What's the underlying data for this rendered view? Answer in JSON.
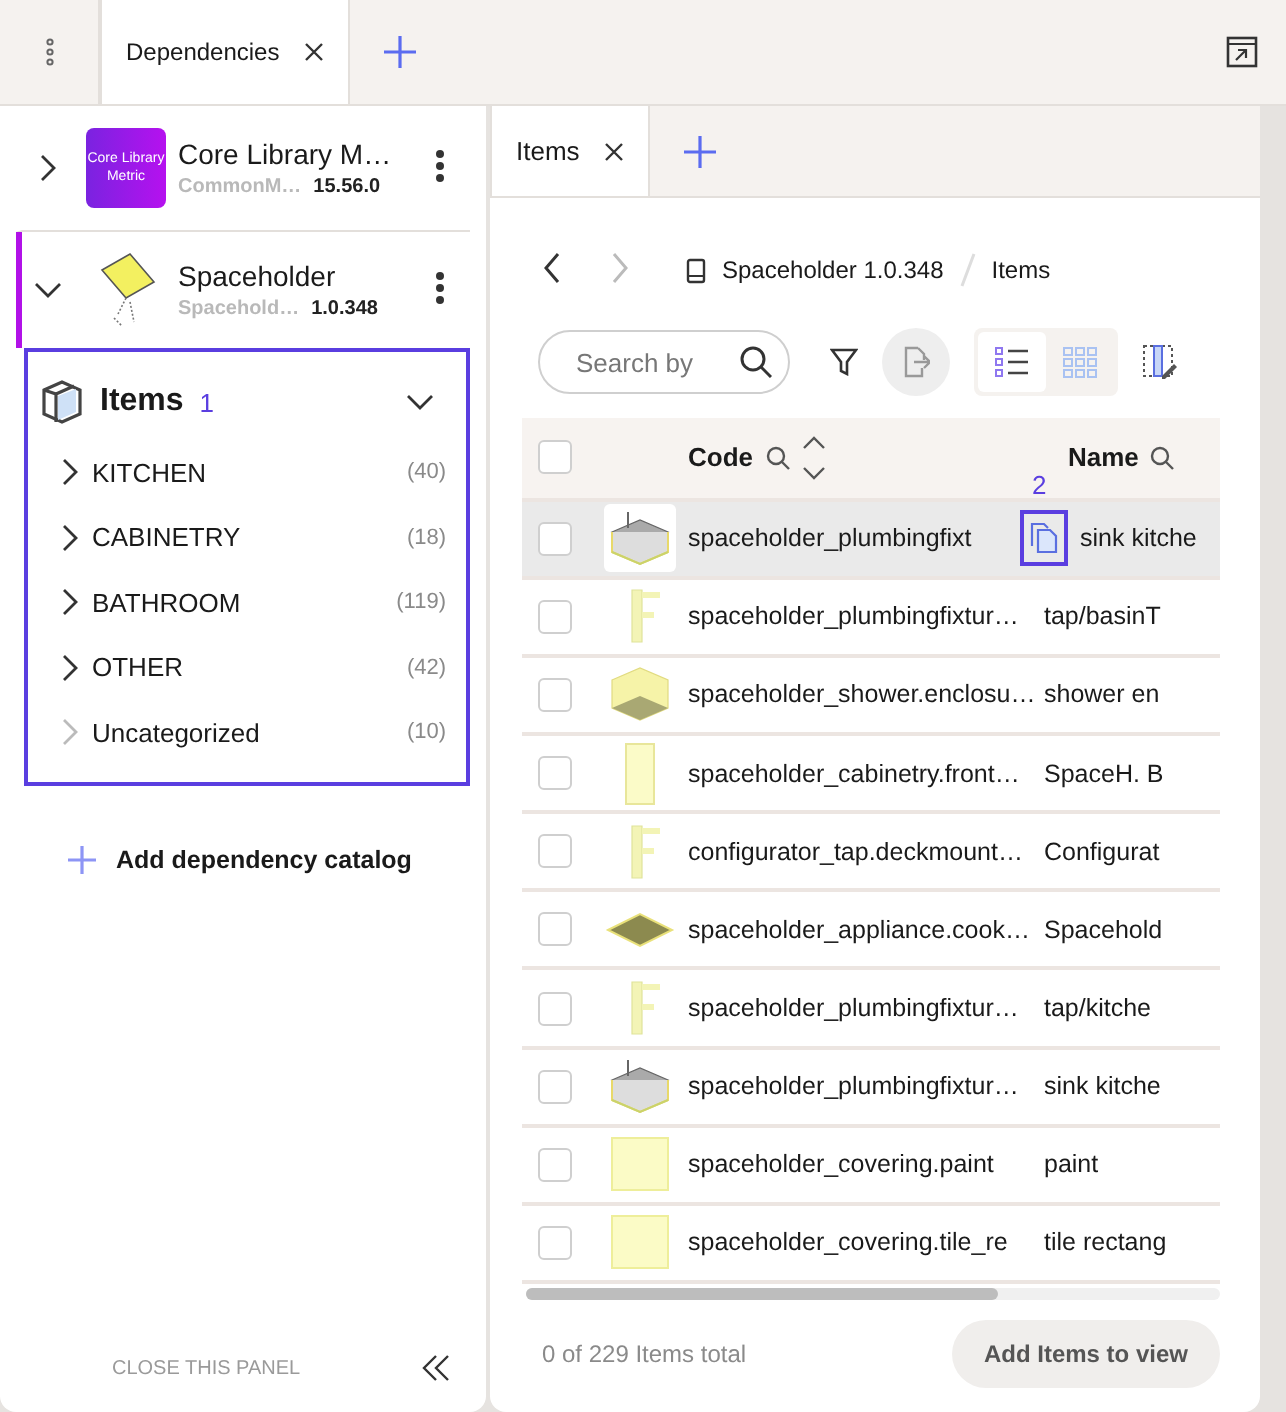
{
  "top_tabs": [
    {
      "label": "Dependencies",
      "selected": true
    }
  ],
  "dependencies": [
    {
      "name": "Core Library M…",
      "source": "CommonM…",
      "version": "15.56.0",
      "expanded": false,
      "active": false,
      "thumbnail": {
        "kind": "logo",
        "text": "Core Library Metric"
      }
    },
    {
      "name": "Spaceholder",
      "source": "Spacehold…",
      "version": "1.0.348",
      "expanded": true,
      "active": true,
      "thumbnail": {
        "kind": "sketch"
      }
    }
  ],
  "items_section": {
    "title": "Items",
    "marker": "1",
    "expanded": true,
    "highlighted": true,
    "categories": [
      {
        "label": "KITCHEN",
        "count": "(40)",
        "has_children": true
      },
      {
        "label": "CABINETRY",
        "count": "(18)",
        "has_children": true
      },
      {
        "label": "BATHROOM",
        "count": "(119)",
        "has_children": true
      },
      {
        "label": "OTHER",
        "count": "(42)",
        "has_children": true
      },
      {
        "label": "Uncategorized",
        "count": "(10)",
        "has_children": false
      }
    ]
  },
  "add_catalog": "Add dependency catalog",
  "close_panel": "CLOSE THIS PANEL",
  "right_tabs": [
    {
      "label": "Items",
      "selected": true
    }
  ],
  "breadcrumb": [
    "Spaceholder 1.0.348",
    "Items"
  ],
  "search": {
    "placeholder": "Search by"
  },
  "view_modes": [
    {
      "kind": "list",
      "selected": true
    },
    {
      "kind": "grid",
      "selected": false
    }
  ],
  "table": {
    "columns": [
      "Code",
      "Name"
    ],
    "all_checked": false,
    "rows": [
      {
        "kind": "sink",
        "code": "spaceholder_plumbingfixt",
        "name": "sink kitche",
        "checked": false,
        "hovered": true,
        "copy_marker": "2"
      },
      {
        "kind": "tap",
        "code": "spaceholder_plumbingfixtur…",
        "name": "tap/basinT",
        "checked": false,
        "hovered": false
      },
      {
        "kind": "shower",
        "code": "spaceholder_shower.enclosu…",
        "name": "shower en",
        "checked": false,
        "hovered": false
      },
      {
        "kind": "panel",
        "code": "spaceholder_cabinetry.front…",
        "name": "SpaceH. B",
        "checked": false,
        "hovered": false
      },
      {
        "kind": "tap",
        "code": "configurator_tap.deckmount…",
        "name": "Configurat",
        "checked": false,
        "hovered": false
      },
      {
        "kind": "cooktop",
        "code": "spaceholder_appliance.cook…",
        "name": "Spacehold",
        "checked": false,
        "hovered": false
      },
      {
        "kind": "tap",
        "code": "spaceholder_plumbingfixtur…",
        "name": "tap/kitche",
        "checked": false,
        "hovered": false
      },
      {
        "kind": "sink",
        "code": "spaceholder_plumbingfixtur…",
        "name": "sink kitche",
        "checked": false,
        "hovered": false
      },
      {
        "kind": "swatch",
        "code": "spaceholder_covering.paint",
        "name": "paint",
        "checked": false,
        "hovered": false
      },
      {
        "kind": "swatch",
        "code": "spaceholder_covering.tile_re",
        "name": "tile rectang",
        "checked": false,
        "hovered": false
      }
    ]
  },
  "footer": {
    "total": "0 of 229 Items total",
    "button": "Add Items to view"
  }
}
